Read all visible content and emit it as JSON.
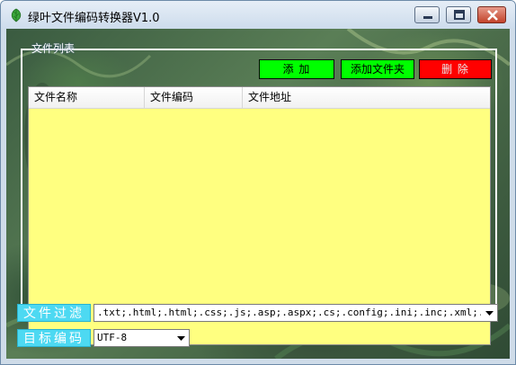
{
  "window": {
    "title": "绿叶文件编码转换器V1.0",
    "app_icon": "green-leaf-icon",
    "controls": [
      "minimize-icon",
      "maximize-icon",
      "close-icon"
    ]
  },
  "group": {
    "legend": "文件列表"
  },
  "buttons": {
    "add": "添 加",
    "add_folder": "添加文件夹",
    "delete": "删 除"
  },
  "file_list": {
    "columns": [
      "文件名称",
      "文件编码",
      "文件地址"
    ],
    "rows": []
  },
  "filter": {
    "label": "文件过滤",
    "value": ".txt;.html;.html;.css;.js;.asp;.aspx;.cs;.config;.ini;.inc;.xml;."
  },
  "encoding": {
    "label": "目标编码",
    "value": "UTF-8"
  },
  "colors": {
    "list_background": "#ffff80",
    "add_button": "#00ff00",
    "delete_button": "#ff0000",
    "label_background": "#4dd9f2"
  }
}
